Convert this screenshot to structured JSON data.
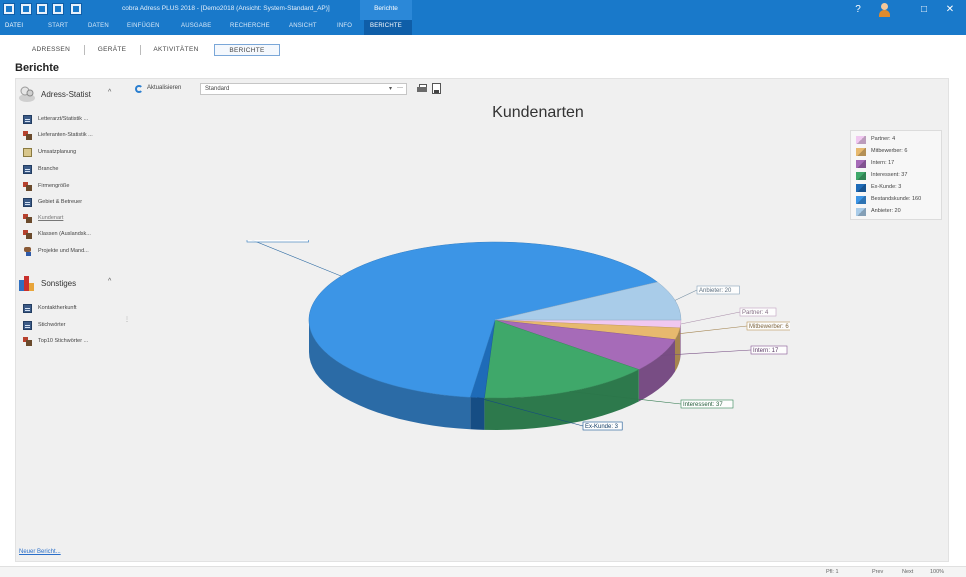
{
  "titlebar": {
    "app_title": "cobra Adress PLUS 2018 - [Demo2018 (Ansicht: System-Standard_AP)]",
    "context_tab": "Berichte",
    "win_controls": {
      "help": "?",
      "restore": "□",
      "close": "✕"
    }
  },
  "menu": {
    "file": "DATEI",
    "items": [
      "START",
      "DATEN",
      "EINFÜGEN",
      "AUSGABE",
      "RECHERCHE",
      "ANSICHT",
      "INFO",
      "BERICHTE"
    ]
  },
  "tabs": [
    {
      "label": "ADRESSEN",
      "active": false
    },
    {
      "label": "GERÄTE",
      "active": false
    },
    {
      "label": "AKTIVITÄTEN",
      "active": false
    },
    {
      "label": "BERICHTE",
      "active": true
    }
  ],
  "page_title": "Berichte",
  "sidebar": {
    "group1": {
      "label": "Adress-Statist",
      "chevron": "^",
      "items": [
        {
          "label": "Letterarzt/Statistik ...",
          "icon": "table"
        },
        {
          "label": "Lieferanten-Statistik ...",
          "icon": "bars"
        },
        {
          "label": "Umsatzplanung",
          "icon": "calendar"
        },
        {
          "label": "Branche",
          "icon": "table"
        },
        {
          "label": "Firmengröße",
          "icon": "bars"
        },
        {
          "label": "Gebiet & Betreuer",
          "icon": "table"
        },
        {
          "label": "Kundenart",
          "icon": "bars",
          "selected": true
        },
        {
          "label": "Klassen (Auslandsk...",
          "icon": "bars"
        },
        {
          "label": "Projekte und Mand...",
          "icon": "person"
        }
      ]
    },
    "group2": {
      "label": "Sonstiges",
      "chevron": "^",
      "items": [
        {
          "label": "Kontaktherkunft",
          "icon": "table"
        },
        {
          "label": "Stichwörter",
          "icon": "table"
        },
        {
          "label": "Top10 Stichwörter ...",
          "icon": "bars"
        }
      ]
    },
    "new_report_link": "Neuer Bericht..."
  },
  "toolbar": {
    "refresh_label": "Aktualisieren",
    "layout_value": "Standard",
    "dropdown_arrow": "▾",
    "clear_glyph": "—"
  },
  "chart_data": {
    "type": "pie",
    "title": "Kundenarten",
    "legend_position": "top-right",
    "slices": [
      {
        "name": "Partner",
        "value": 4,
        "color": "#f0c8f0",
        "legend": "Partner: 4",
        "label": "Partner: 4"
      },
      {
        "name": "Mitbewerber",
        "value": 6,
        "color": "#e7b96e",
        "legend": "Mitbewerber: 6",
        "label": "Mitbewerber: 6"
      },
      {
        "name": "Intern",
        "value": 17,
        "color": "#a66bb8",
        "legend": "Intern: 17",
        "label": "Intern: 17"
      },
      {
        "name": "Interessent",
        "value": 37,
        "color": "#3fa86a",
        "legend": "Interessent: 37",
        "label": "Interessent: 37"
      },
      {
        "name": "Ex-Kunde",
        "value": 3,
        "color": "#1e6bb8",
        "legend": "Ex-Kunde: 3",
        "label": "Ex-Kunde: 3"
      },
      {
        "name": "Bestandskunde",
        "value": 160,
        "color": "#3c95e6",
        "legend": "Bestandskunde: 160",
        "label": "Bestandskunde: 160"
      },
      {
        "name": "Anbieter",
        "value": 20,
        "color": "#a9cce9",
        "legend": "Anbieter: 20",
        "label": "Anbieter: 20"
      }
    ]
  },
  "statusbar": {
    "items": [
      "Pfl: 1",
      "Prev",
      "Next",
      "100%"
    ]
  }
}
